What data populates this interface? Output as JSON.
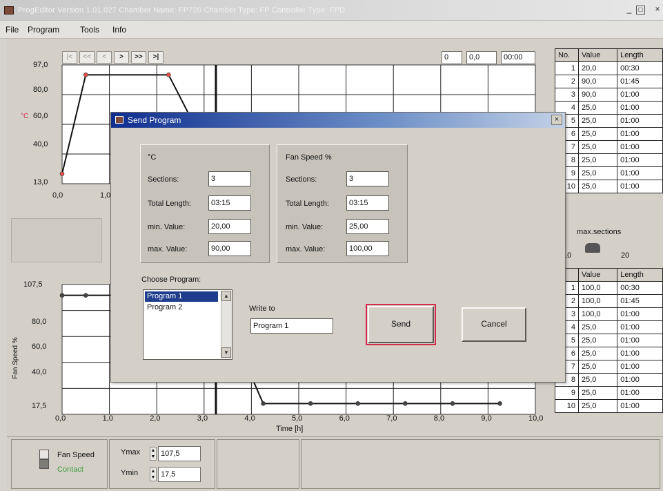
{
  "window": {
    "title": "ProgEditor Version 1.01.027    Chamber Name: FP720    Chamber Type: FP    Controller Type: FPD",
    "minimize": "_",
    "maximize": "□",
    "close": "×"
  },
  "menu": [
    "File",
    "Program",
    "Tools",
    "Info"
  ],
  "nav": {
    "buttons": [
      "|<",
      "<<",
      "<",
      ">",
      ">>",
      ">|"
    ],
    "fields": [
      "0",
      "0,0",
      "00:00"
    ]
  },
  "chart_data": [
    {
      "type": "line",
      "title": "",
      "ylabel": "°C",
      "y_ticks": [
        "97,0",
        "80,0",
        "60,0",
        "40,0",
        "13,0"
      ],
      "x_ticks": [
        "0,0",
        "1,0"
      ],
      "ylim": [
        13.0,
        97.0
      ],
      "x": [
        0.0,
        0.5,
        2.25,
        3.25
      ],
      "series": [
        {
          "values": [
            20.0,
            90.0,
            90.0,
            25.0
          ]
        }
      ]
    },
    {
      "type": "line",
      "title": "",
      "xlabel": "Time [h]",
      "ylabel": "Fan Speed %",
      "y_ticks": [
        "107,5",
        "80,0",
        "60,0",
        "40,0",
        "17,5"
      ],
      "x_ticks": [
        "0,0",
        "1,0",
        "2,0",
        "3,0",
        "4,0",
        "5,0",
        "6,0",
        "7,0",
        "8,0",
        "9,0",
        "10,0"
      ],
      "ylim": [
        17.5,
        107.5
      ],
      "xlim": [
        0.0,
        10.0
      ],
      "x": [
        0.0,
        0.5,
        3.25,
        4.25,
        5.25,
        6.25,
        7.25,
        8.25,
        9.25
      ],
      "series": [
        {
          "values": [
            100.0,
            100.0,
            100.0,
            25.0,
            25.0,
            25.0,
            25.0,
            25.0,
            25.0
          ]
        }
      ]
    }
  ],
  "table_top": {
    "headers": [
      "No.",
      "Value",
      "Length"
    ],
    "rows": [
      [
        "1",
        "20,0",
        "00:30"
      ],
      [
        "2",
        "90,0",
        "01:45"
      ],
      [
        "3",
        "90,0",
        "01:00"
      ],
      [
        "4",
        "25,0",
        "01:00"
      ],
      [
        "5",
        "25,0",
        "01:00"
      ],
      [
        "6",
        "25,0",
        "01:00"
      ],
      [
        "7",
        "25,0",
        "01:00"
      ],
      [
        "8",
        "25,0",
        "01:00"
      ],
      [
        "9",
        "25,0",
        "01:00"
      ],
      [
        "10",
        "25,0",
        "01:00"
      ]
    ]
  },
  "max_sections": {
    "label": "max.sections",
    "min": "10",
    "max": "20"
  },
  "table_bottom": {
    "headers": [
      ".",
      "Value",
      "Length"
    ],
    "rows": [
      [
        "1",
        "100,0",
        "00:30"
      ],
      [
        "2",
        "100,0",
        "01:45"
      ],
      [
        "3",
        "100,0",
        "01:00"
      ],
      [
        "4",
        "25,0",
        "01:00"
      ],
      [
        "5",
        "25,0",
        "01:00"
      ],
      [
        "6",
        "25,0",
        "01:00"
      ],
      [
        "7",
        "25,0",
        "01:00"
      ],
      [
        "8",
        "25,0",
        "01:00"
      ],
      [
        "9",
        "25,0",
        "01:00"
      ],
      [
        "10",
        "25,0",
        "01:00"
      ]
    ]
  },
  "dialog": {
    "title": "Send Program",
    "close": "×",
    "temp": {
      "heading": "°C",
      "sections_label": "Sections:",
      "sections": "3",
      "total_label": "Total Length:",
      "total": "03:15",
      "min_label": "min. Value:",
      "min": "20,00",
      "max_label": "max. Value:",
      "max": "90,00"
    },
    "fan": {
      "heading": "Fan Speed %",
      "sections_label": "Sections:",
      "sections": "3",
      "total_label": "Total Length:",
      "total": "03:15",
      "min_label": "min. Value:",
      "min": "25,00",
      "max_label": "max. Value:",
      "max": "100,00"
    },
    "choose_label": "Choose Program:",
    "programs": [
      "Program 1",
      "Program 2"
    ],
    "write_to_label": "Write to",
    "write_to": "Program 1",
    "send": "Send",
    "cancel": "Cancel"
  },
  "status": {
    "fan_speed": "Fan Speed",
    "contact": "Contact",
    "ymax_label": "Ymax",
    "ymax": "107,5",
    "ymin_label": "Ymin",
    "ymin": "17,5"
  },
  "colors": {
    "dialog_title": "#0f2e8f",
    "send_border": "#d62a4a",
    "contact_text": "#3a9a3a",
    "point_marker": "#e0504a"
  }
}
